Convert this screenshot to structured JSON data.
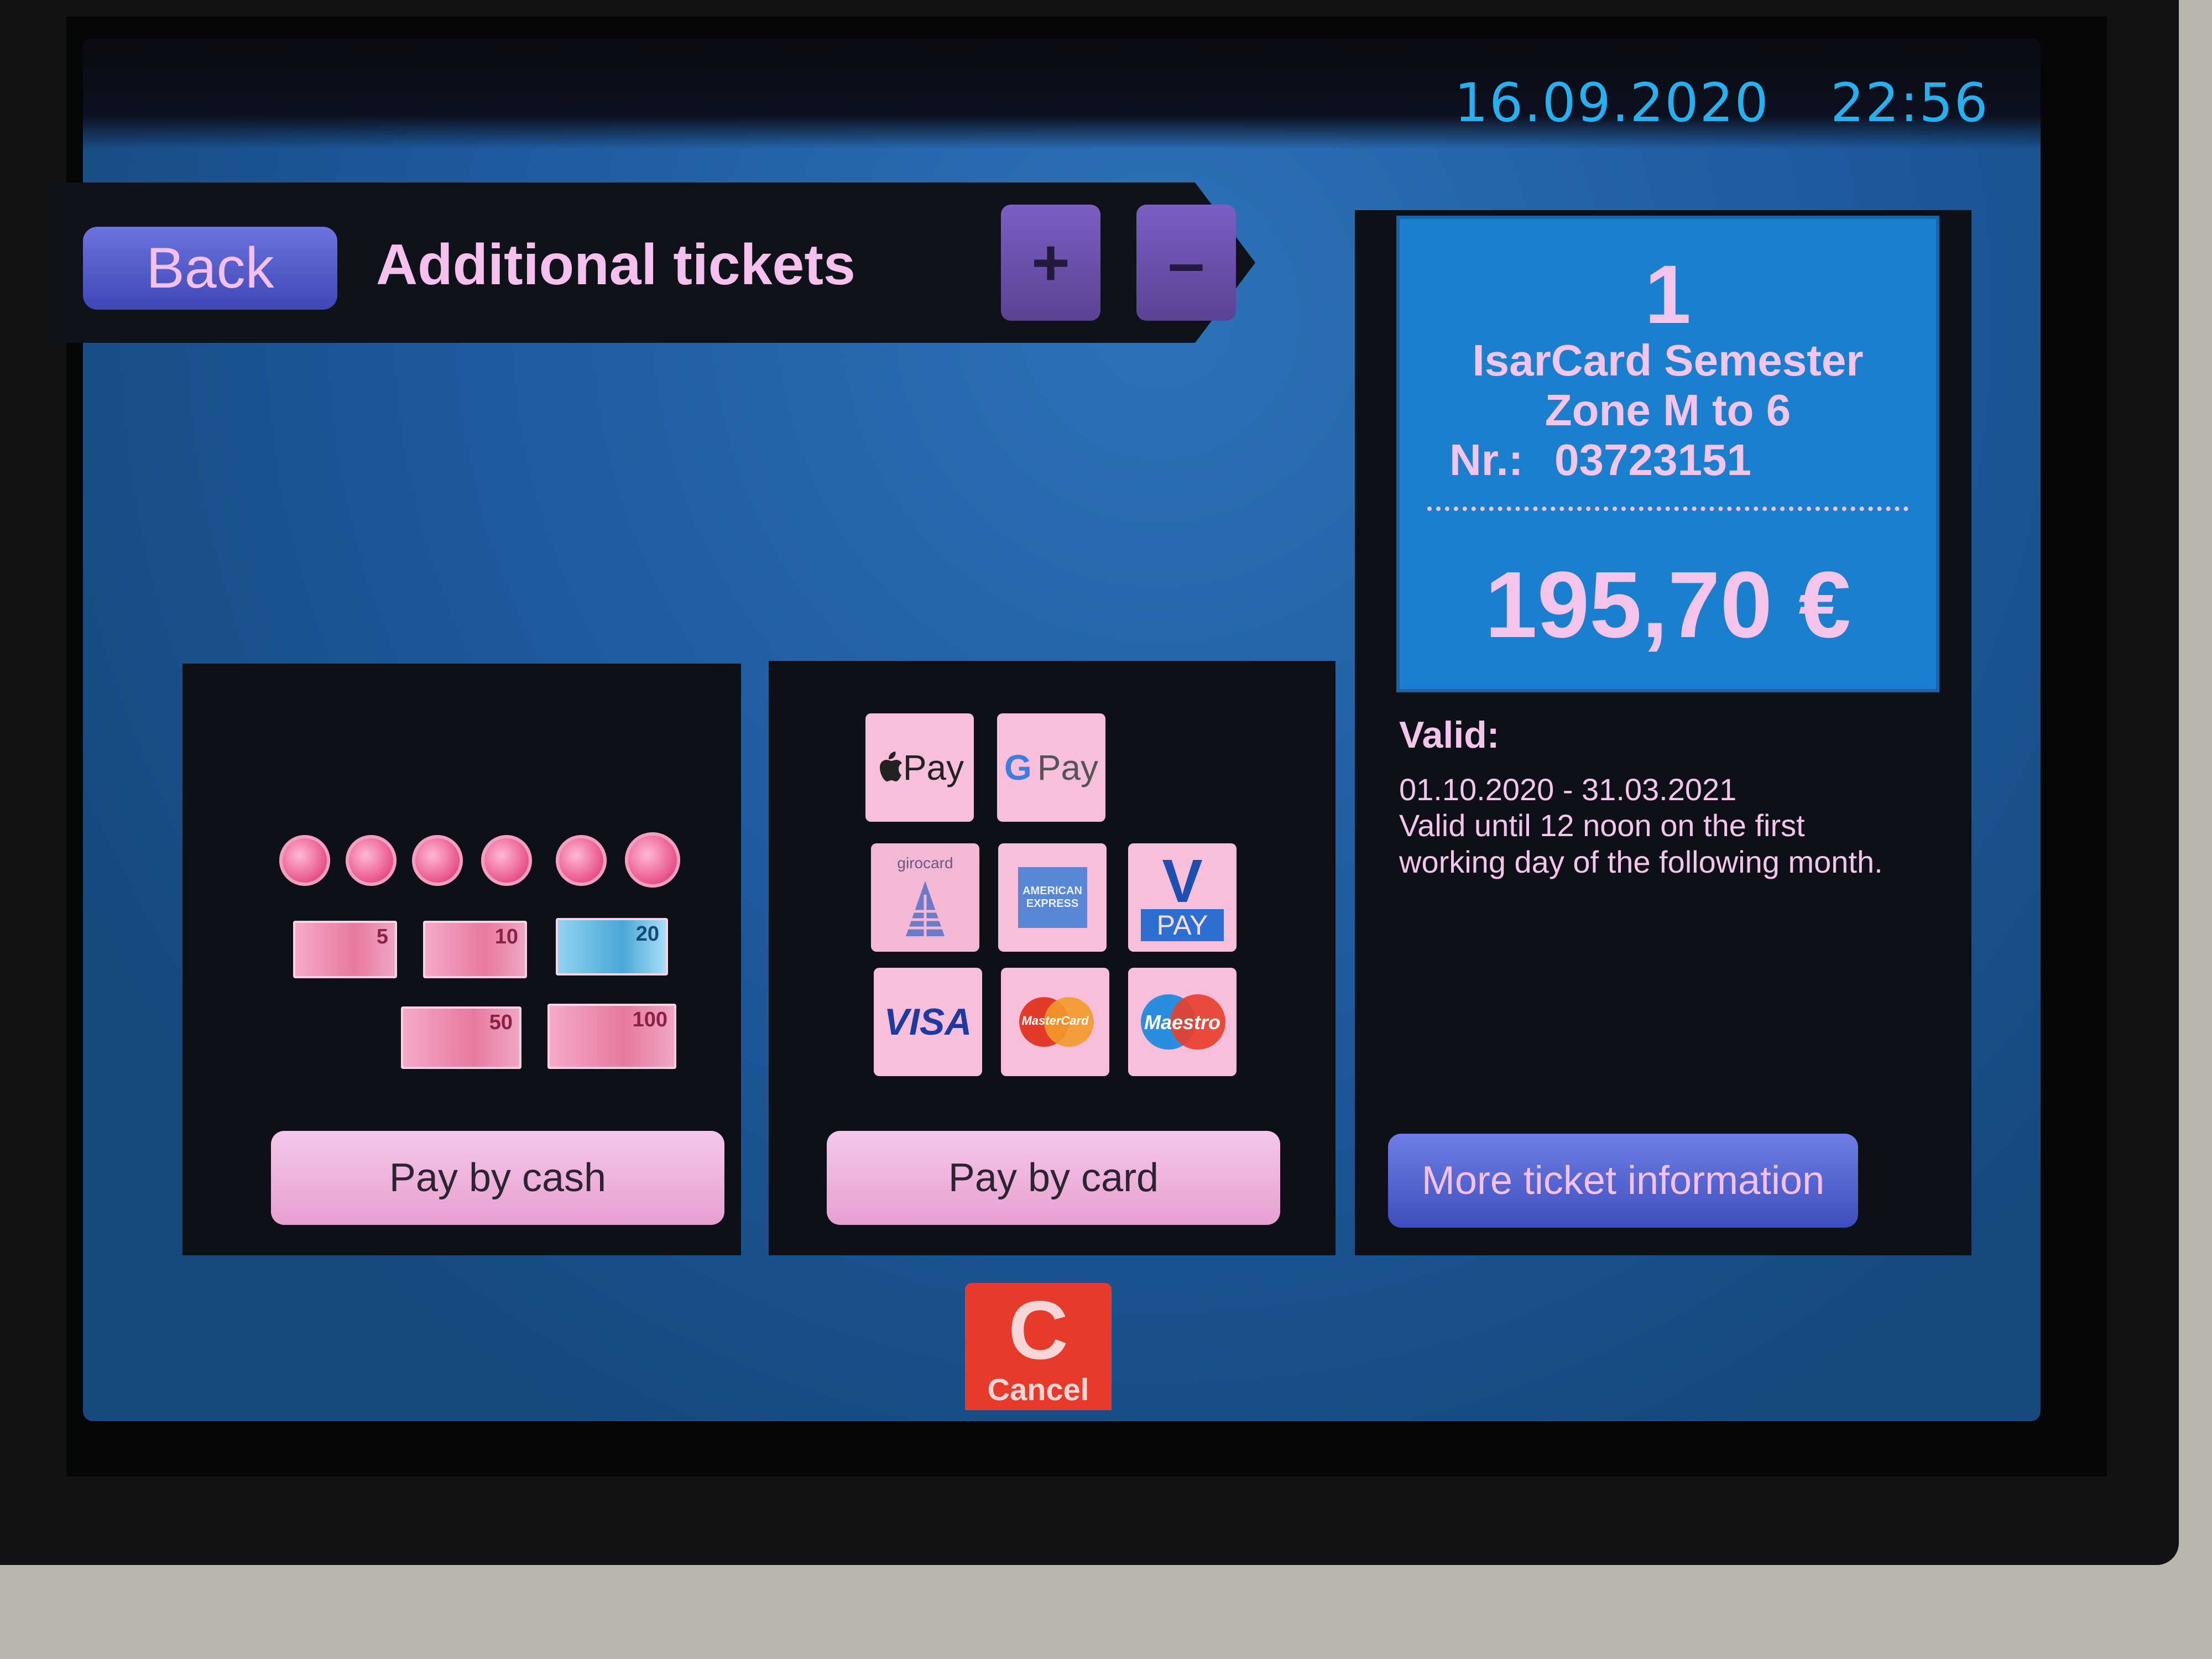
{
  "status": {
    "date": "16.09.2020",
    "time": "22:56"
  },
  "header": {
    "back_label": "Back",
    "title": "Additional tickets",
    "plus_label": "+",
    "minus_label": "–"
  },
  "payment": {
    "cash_label": "Pay by cash",
    "card_label": "Pay by card",
    "notes": [
      "5",
      "10",
      "20",
      "50",
      "100"
    ],
    "logos": {
      "apple_pay": "Pay",
      "google_pay": "Pay",
      "girocard": "girocard",
      "amex": "AMERICAN EXPRESS",
      "vpay_v": "V",
      "vpay_pay": "PAY",
      "visa": "VISA",
      "mastercard": "MasterCard",
      "maestro": "Maestro"
    }
  },
  "ticket": {
    "quantity": "1",
    "name": "IsarCard Semester",
    "zone": "Zone M to 6",
    "nr_label": "Nr.:",
    "nr_value": "03723151",
    "price": "195,70 €"
  },
  "validity": {
    "title": "Valid:",
    "dates": "01.10.2020 - 31.03.2021",
    "note": "Valid until 12 noon on the first working day of the following month."
  },
  "more_info_label": "More ticket information",
  "cancel": {
    "letter": "C",
    "label": "Cancel"
  }
}
